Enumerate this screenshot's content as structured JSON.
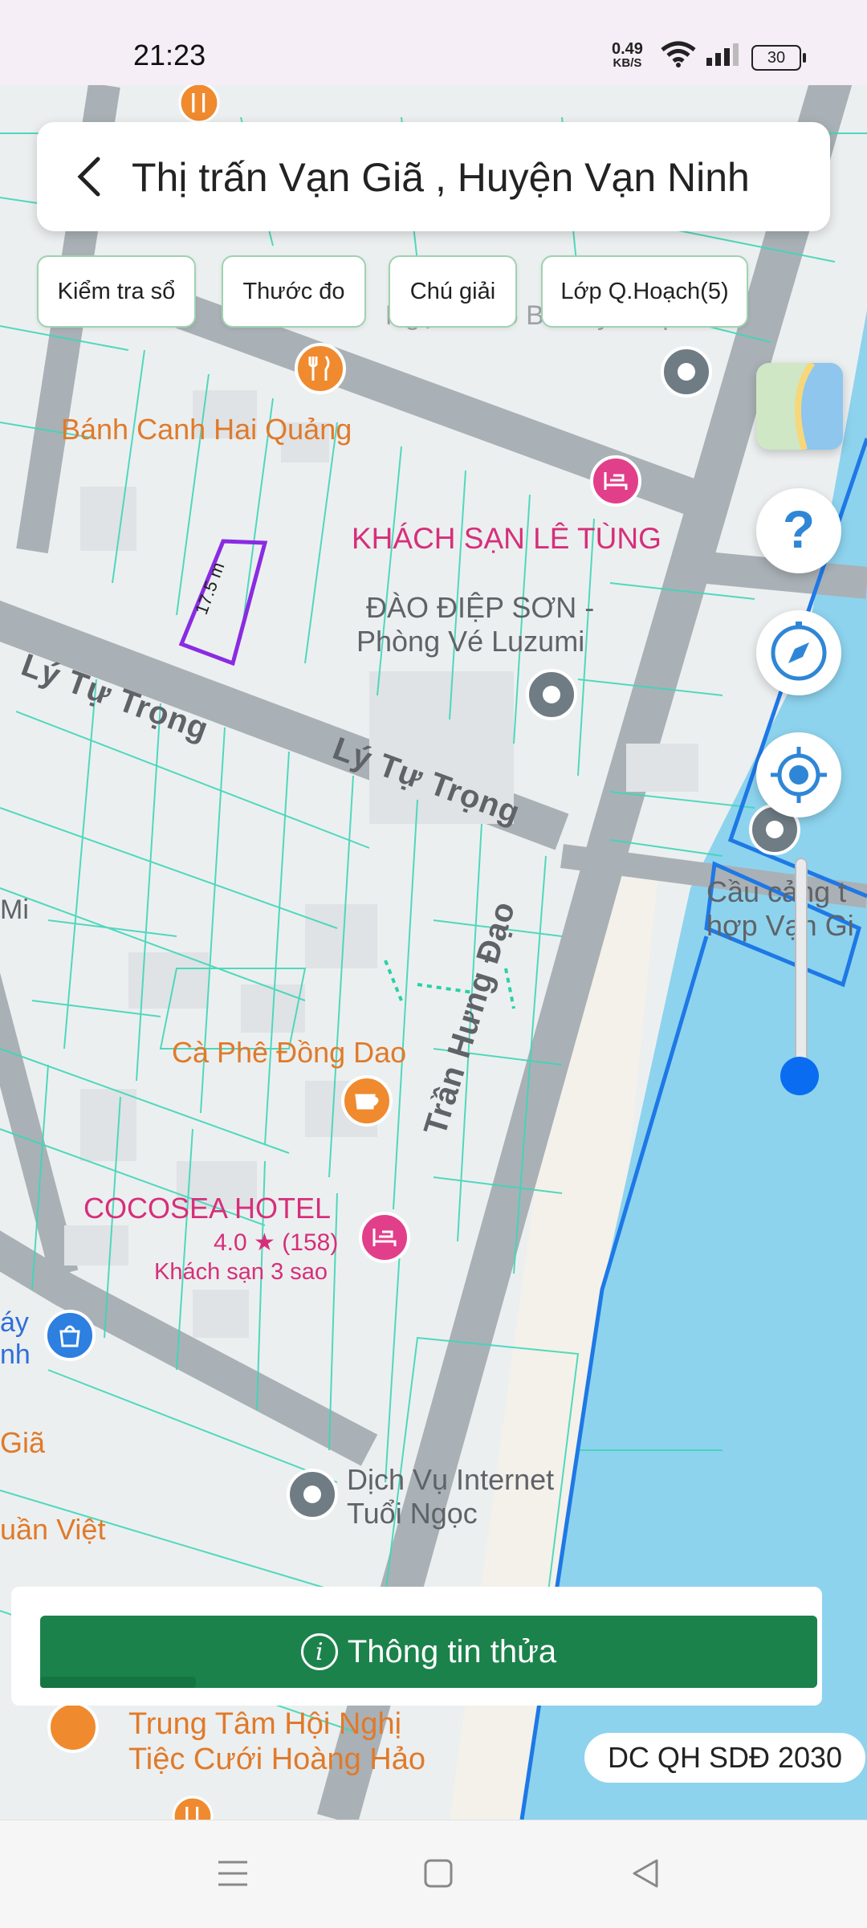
{
  "status_bar": {
    "time": "21:23",
    "network_speed_value": "0.49",
    "network_speed_unit": "KB/S",
    "battery": "30"
  },
  "header": {
    "title": "Thị trấn Vạn Giã , Huyện Vạn Ninh"
  },
  "toolbar": {
    "chips": [
      "Kiểm tra sổ",
      "Thước đo",
      "Chú giải",
      "Lớp Q.Hoạch(5)"
    ]
  },
  "map": {
    "labels": {
      "ngoc_thao": "Ngọc Thảo Beauty & Spa",
      "banh_canh": "Bánh Canh Hai Quảng",
      "khach_san": "KHÁCH SẠN LÊ TÙNG",
      "dao_diep_son_1": "ĐÀO ĐIỆP SƠN -",
      "dao_diep_son_2": "Phòng Vé Luzumi",
      "ly_tu_trong_1": "Lý Tự Trọng",
      "ly_tu_trong_2": "Lý Tự Trọng",
      "tran_hung_dao": "Trần Hưng Đạo",
      "cau_cang_1": "Cầu cảng t",
      "cau_cang_2": "hợp Vạn Gi",
      "mi": "Mi",
      "ca_phe": "Cà Phê Đồng Dao",
      "cocosea": "COCOSEA HOTEL",
      "cocosea_rating": "4.0 ★ (158)",
      "cocosea_class": "Khách sạn 3 sao",
      "ay": "áy",
      "nh": "nh",
      "gia": "Giã",
      "uan_viet": "uần Việt",
      "dich_vu_1": "Dịch Vụ Internet",
      "dich_vu_2": "Tuổi Ngọc",
      "trung_tam_1": "Trung Tâm Hội Nghị",
      "trung_tam_2": "Tiệc Cưới Hoàng Hảo",
      "measurement": "17.5 m"
    }
  },
  "bottom": {
    "info_button": "Thông tin thửa",
    "info_icon": "i",
    "plan_badge": "DC QH SDĐ 2030"
  },
  "icons": {
    "back": "chevron-left-icon",
    "help": "question-icon",
    "compass": "compass-icon",
    "locate": "crosshair-icon",
    "layers": "map-layers-icon"
  },
  "colors": {
    "accent_green": "#1c824c",
    "parcel_lines": "#3fd6b8",
    "water": "#8dd3ee",
    "boundary_blue": "#1e78e6",
    "selected_parcel": "#8a2be2",
    "slider_blue": "#0a6cf0"
  },
  "zoom_slider": {
    "level": 0.9
  }
}
